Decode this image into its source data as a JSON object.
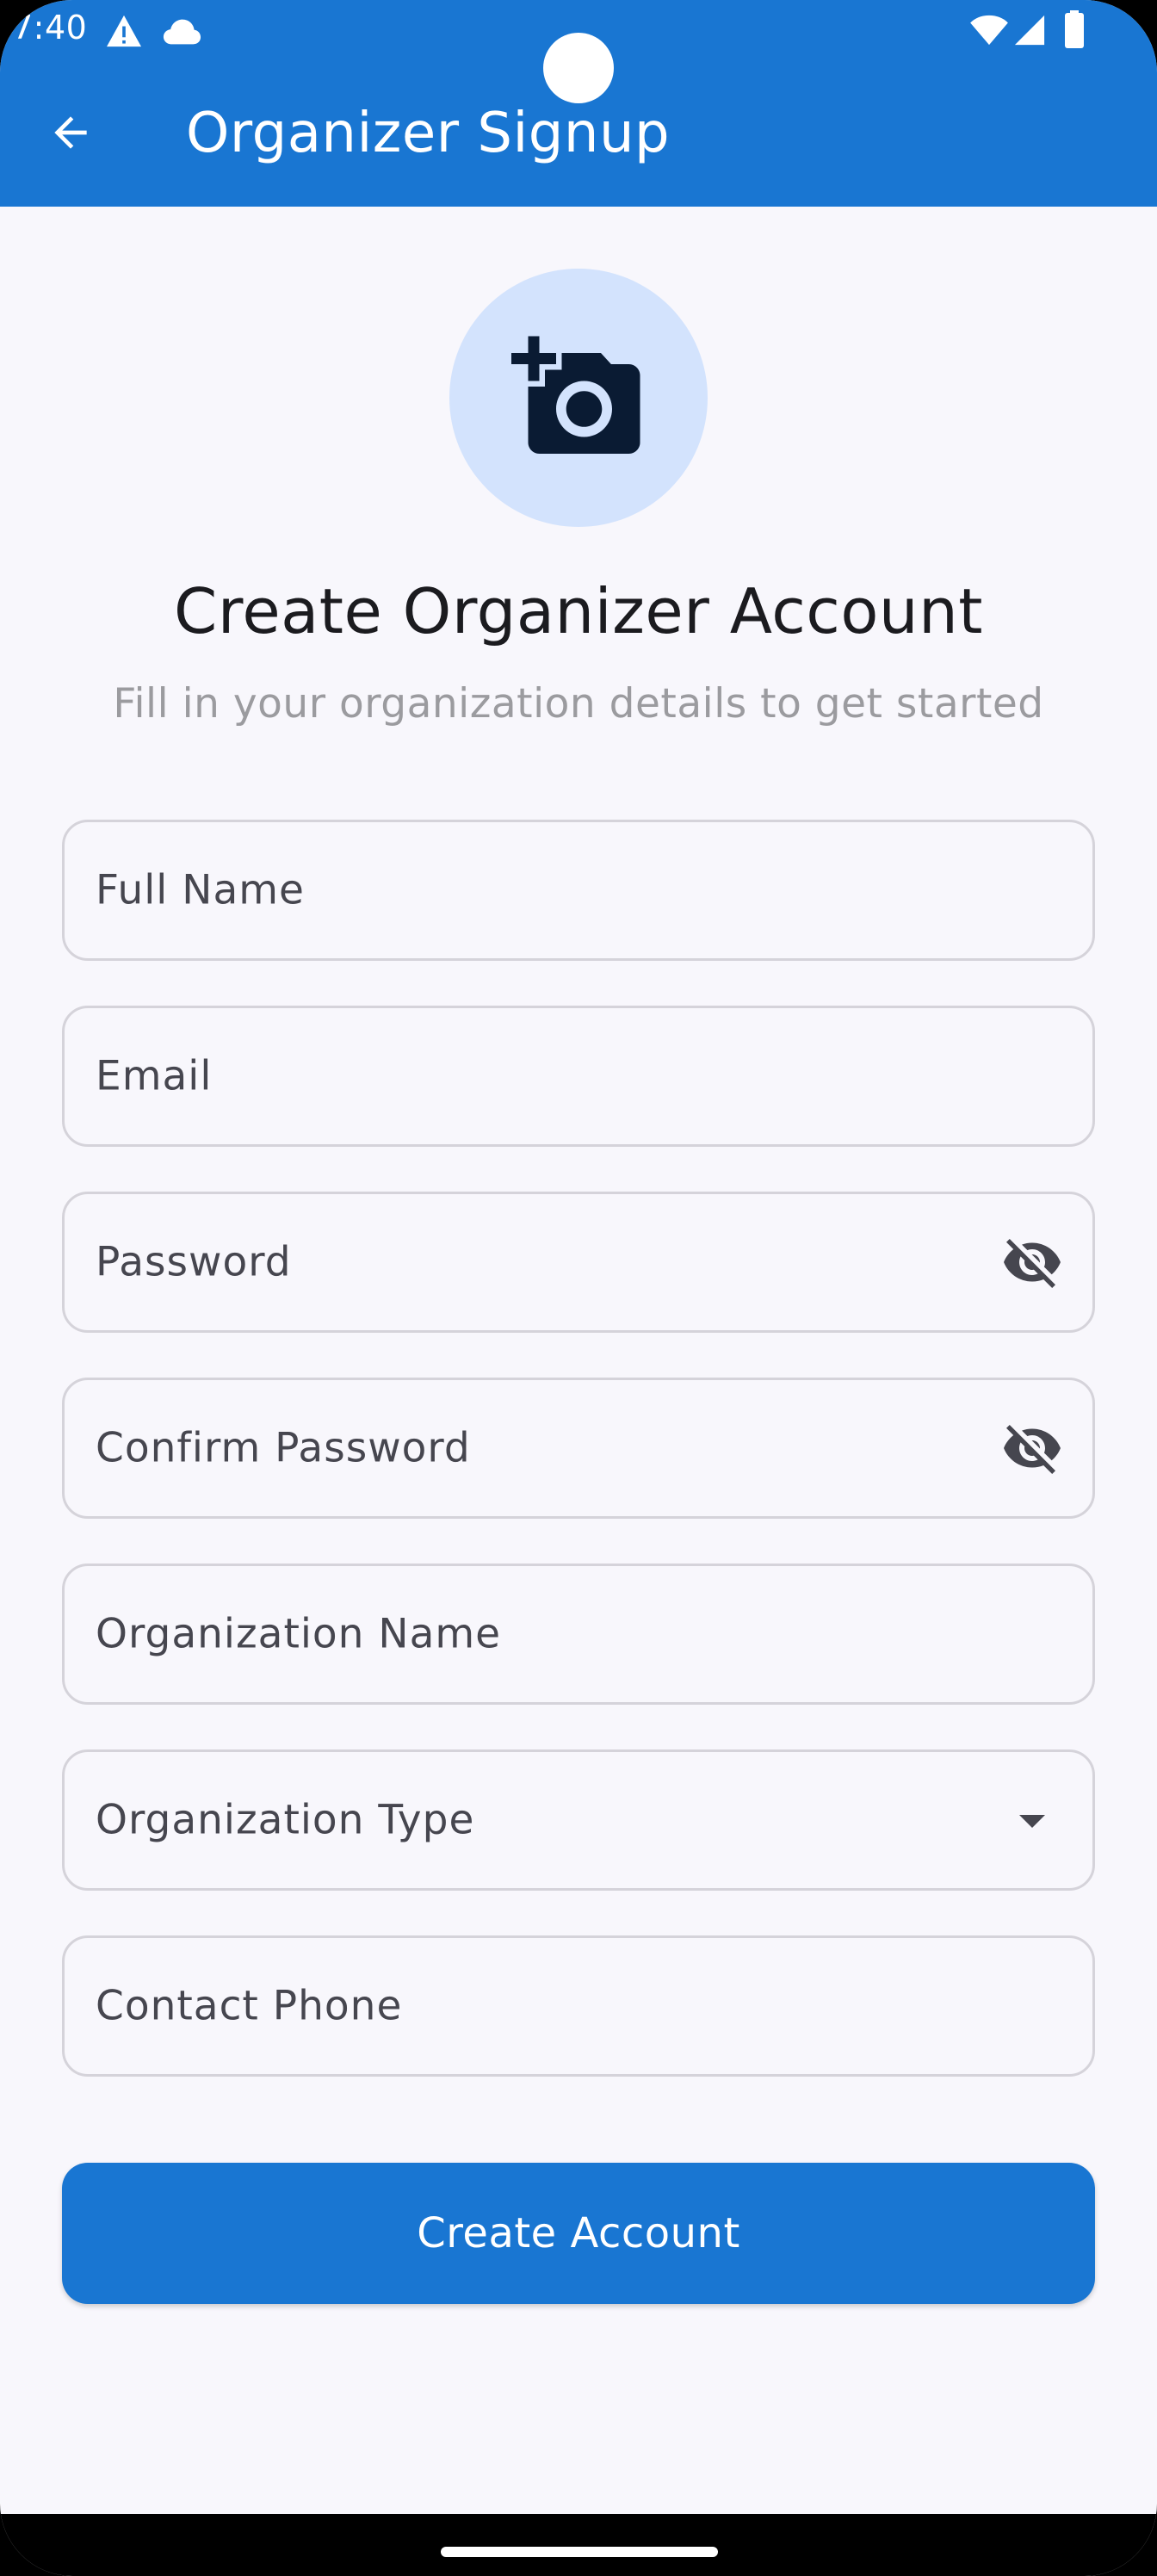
{
  "status_bar": {
    "time": "7:40",
    "icons": [
      "warning-icon",
      "cloud-icon",
      "wifi-icon",
      "cell-signal-icon",
      "battery-icon"
    ]
  },
  "appbar": {
    "title": "Organizer Signup",
    "back_icon": "arrow-back-icon",
    "background_color": "#1976d2"
  },
  "header": {
    "avatar_icon": "add-a-photo-icon",
    "avatar_background": "#d3e3fd",
    "title": "Create Organizer Account",
    "subtitle": "Fill in your organization details to get started"
  },
  "form": {
    "fields": [
      {
        "label": "Full Name",
        "value": ""
      },
      {
        "label": "Email",
        "value": ""
      },
      {
        "label": "Password",
        "value": "",
        "trailing_icon": "visibility-off-icon"
      },
      {
        "label": "Confirm Password",
        "value": "",
        "trailing_icon": "visibility-off-icon"
      },
      {
        "label": "Organization Name",
        "value": ""
      },
      {
        "label": "Organization Type",
        "value": "",
        "trailing_icon": "dropdown-arrow-icon"
      },
      {
        "label": "Contact Phone",
        "value": ""
      }
    ],
    "submit_label": "Create Account"
  }
}
